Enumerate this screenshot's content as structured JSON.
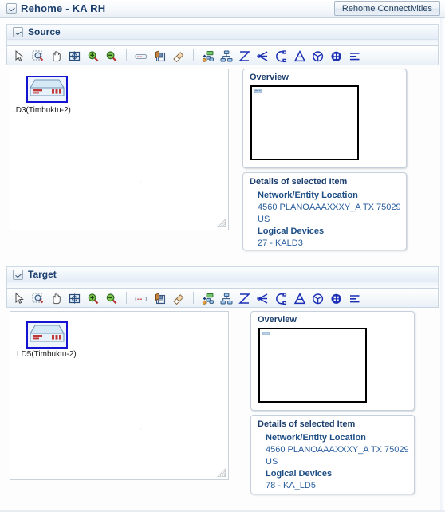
{
  "header": {
    "title": "Rehome - KA RH",
    "disclose_icon": "chevron-down-icon",
    "rehome_button": "Rehome Connectivities"
  },
  "toolbar": {
    "icons": [
      {
        "name": "select-pointer-icon",
        "tip": "Select"
      },
      {
        "name": "marquee-zoom-icon",
        "tip": "Marquee Zoom"
      },
      {
        "name": "pan-hand-icon",
        "tip": "Pan"
      },
      {
        "name": "zoom-fit-icon",
        "tip": "Zoom to Fit"
      },
      {
        "name": "zoom-in-icon",
        "tip": "Zoom In"
      },
      {
        "name": "zoom-out-icon",
        "tip": "Zoom Out"
      },
      {
        "name": "device-icon",
        "tip": "Device"
      },
      {
        "name": "save-image-icon",
        "tip": "Save Image"
      },
      {
        "name": "eraser-icon",
        "tip": "Clear"
      },
      {
        "name": "expand-node-icon",
        "tip": "Expand Node"
      },
      {
        "name": "group-nodes-icon",
        "tip": "Group Nodes"
      },
      {
        "name": "layout-incremental-icon",
        "tip": "Incremental Layout"
      },
      {
        "name": "layout-tree-icon",
        "tip": "Tree Layout"
      },
      {
        "name": "layout-circular-icon",
        "tip": "Circular Layout"
      },
      {
        "name": "layout-hierarchical-icon",
        "tip": "Hierarchical Layout"
      },
      {
        "name": "layout-radial-icon",
        "tip": "Radial Layout"
      },
      {
        "name": "layout-grid-icon",
        "tip": "Grid Layout"
      },
      {
        "name": "layout-list-icon",
        "tip": "List Layout"
      }
    ]
  },
  "source": {
    "section_title": "Source",
    "node_label": ".D3(Timbuktu-2)",
    "node_icon": "server-device-icon",
    "overview": {
      "title": "Overview",
      "node_icon": "server-device-mini-icon"
    },
    "details": {
      "title": "Details of selected Item",
      "rows": [
        {
          "key": "Network/Entity Location",
          "value": "4560 PLANOAAAXXXY_A TX 75029 US"
        },
        {
          "key": "Logical Devices",
          "value": "27 - KALD3"
        }
      ]
    }
  },
  "target": {
    "section_title": "Target",
    "node_label": "LD5(Timbuktu-2)",
    "node_icon": "server-device-icon",
    "overview": {
      "title": "Overview",
      "node_icon": "server-device-mini-icon"
    },
    "details": {
      "title": "Details of selected Item",
      "rows": [
        {
          "key": "Network/Entity Location",
          "value": "4560 PLANOAAAXXXY_A TX 75029 US"
        },
        {
          "key": "Logical Devices",
          "value": "78 - KA_LD5"
        }
      ]
    }
  },
  "colors": {
    "title_blue": "#1d3f6e",
    "link_blue": "#2a5e9e",
    "node_border": "#1414d0",
    "panel_border": "#c5d0dc"
  }
}
